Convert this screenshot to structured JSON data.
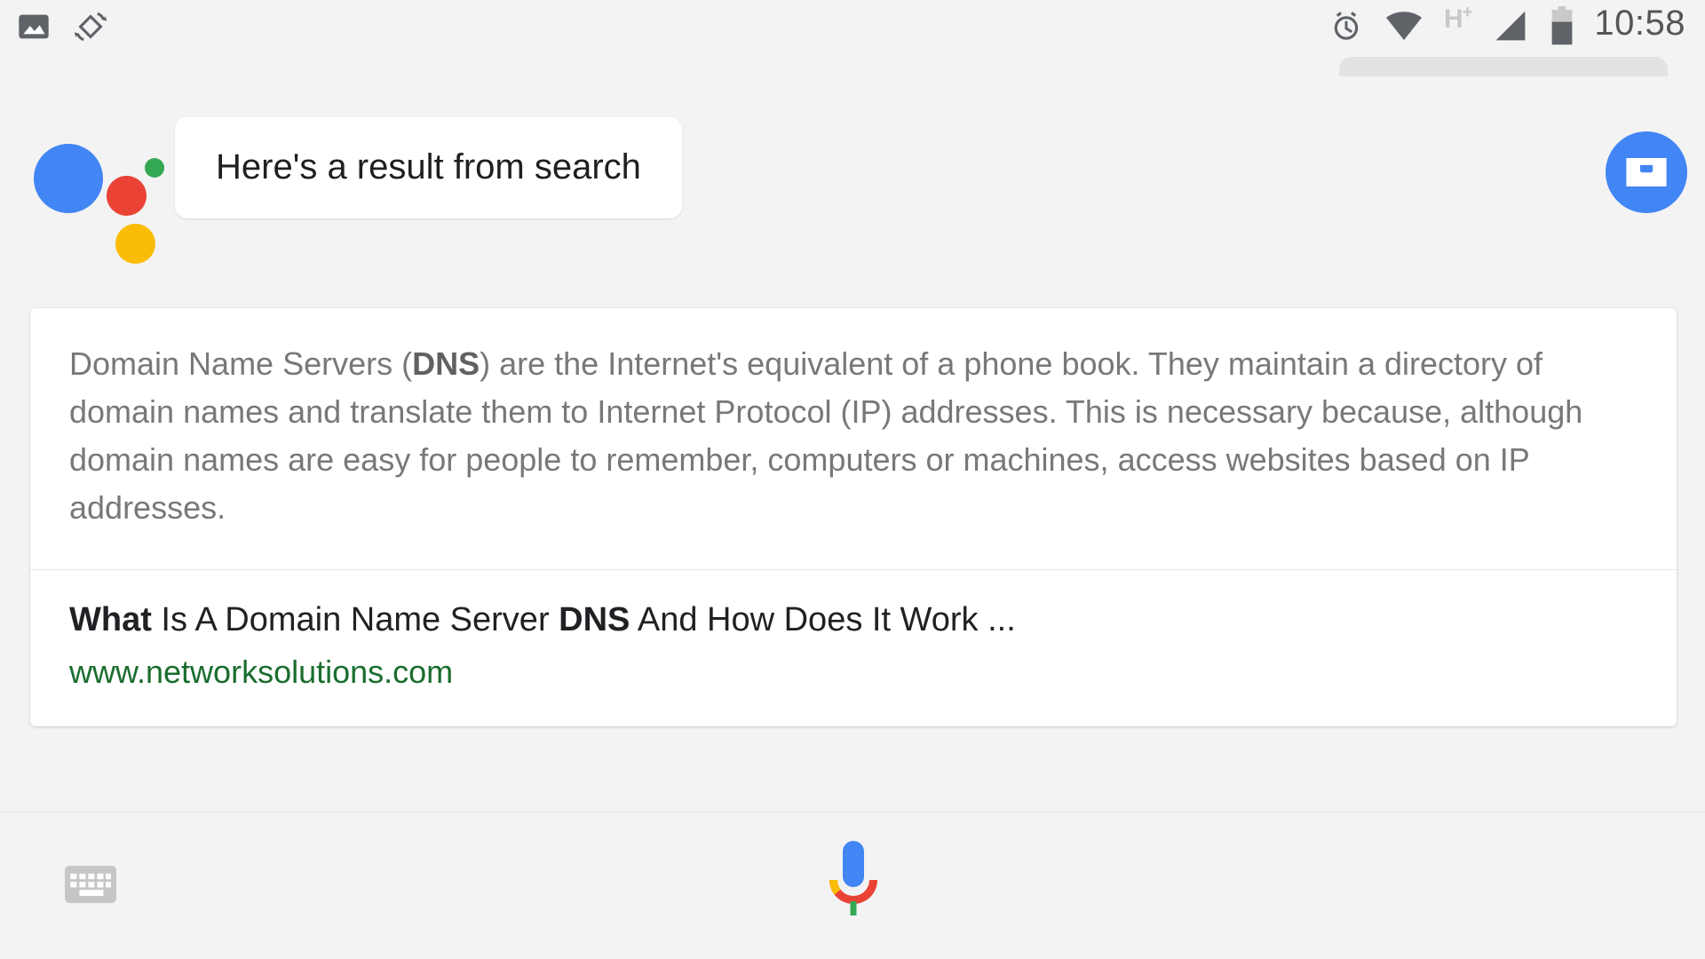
{
  "status_bar": {
    "left_icons": [
      {
        "name": "photo-icon",
        "label": "screenshot"
      },
      {
        "name": "screen-rotation-icon",
        "label": "auto-rotate"
      }
    ],
    "right_icons": [
      {
        "name": "alarm-icon",
        "label": "alarm set"
      },
      {
        "name": "wifi-icon",
        "label": "wifi"
      },
      {
        "name": "network-type-icon",
        "label": "H+"
      },
      {
        "name": "cell-signal-icon",
        "label": "signal"
      },
      {
        "name": "battery-icon",
        "label": "battery"
      }
    ],
    "network_type": "H",
    "network_type_sup": "+",
    "time": "10:58"
  },
  "assistant": {
    "logo_name": "google-assistant-logo",
    "message": "Here's a result from search",
    "inbox_button": {
      "name": "inbox-icon",
      "label": "Inbox"
    }
  },
  "result_card": {
    "snippet": {
      "part1": "Domain Name Servers (",
      "bold1": "DNS",
      "part2": ") are the Internet's equivalent of a phone book. They maintain a directory of domain names and translate them to Internet Protocol (IP) addresses. This is necessary because, although domain names are easy for people to remember, computers or machines, access websites based on IP addresses."
    },
    "link": {
      "title_bold1": "What",
      "title_mid": " Is A Domain Name Server ",
      "title_bold2": "DNS",
      "title_end": " And How Does It Work ...",
      "url": "www.networksolutions.com"
    }
  },
  "bottom_bar": {
    "keyboard_button": {
      "name": "keyboard-icon",
      "label": "Keyboard input"
    },
    "mic_button": {
      "name": "microphone-icon",
      "label": "Voice input"
    }
  },
  "colors": {
    "google_blue": "#4285f4",
    "google_red": "#ea4335",
    "google_yellow": "#fbbc05",
    "google_green": "#34a853",
    "link_green": "#1a6d2e",
    "page_bg": "#f3f3f3",
    "card_bg": "#ffffff",
    "snippet_text": "#77787a"
  }
}
